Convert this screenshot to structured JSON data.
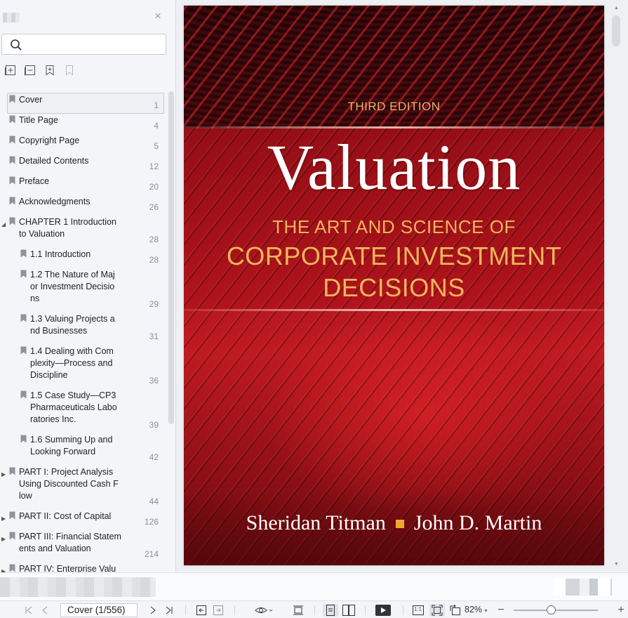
{
  "sidebar": {
    "close_icon": "×",
    "search": {
      "value": "",
      "placeholder": ""
    },
    "tools": [
      "expand-all-icon",
      "collapse-all-icon",
      "add-bookmark-icon",
      "bookmark-outline-icon"
    ],
    "toc": [
      {
        "label": "Cover",
        "page": "1",
        "level": 0,
        "selected": true
      },
      {
        "label": "Title Page",
        "page": "4",
        "level": 0
      },
      {
        "label": "Copyright Page",
        "page": "5",
        "level": 0
      },
      {
        "label": "Detailed Contents",
        "page": "12",
        "level": 0
      },
      {
        "label": "Preface",
        "page": "20",
        "level": 0
      },
      {
        "label": "Acknowledgments",
        "page": "26",
        "level": 0
      },
      {
        "label": "CHAPTER 1 Introduction\nto Valuation",
        "page": "28",
        "level": 0,
        "expanded": true
      },
      {
        "label": "1.1 Introduction",
        "page": "28",
        "level": 1
      },
      {
        "label": "1.2 The Nature of Maj\nor Investment Decisio\nns",
        "page": "29",
        "level": 1
      },
      {
        "label": "1.3 Valuing Projects a\nnd Businesses",
        "page": "31",
        "level": 1
      },
      {
        "label": "1.4 Dealing with Com\nplexity—Process and\nDiscipline",
        "page": "36",
        "level": 1
      },
      {
        "label": "1.5 Case Study—CP3\nPharmaceuticals Labo\nratories Inc.",
        "page": "39",
        "level": 1
      },
      {
        "label": "1.6 Summing Up and\nLooking Forward",
        "page": "42",
        "level": 1
      },
      {
        "label": "PART I: Project Analysis\nUsing Discounted Cash F\nlow",
        "page": "44",
        "level": 0,
        "collapsed": true
      },
      {
        "label": "PART II: Cost of Capital",
        "page": "126",
        "level": 0,
        "collapsed": true
      },
      {
        "label": "PART III: Financial Statem\nents and Valuation",
        "page": "214",
        "level": 0,
        "collapsed": true
      },
      {
        "label": "PART IV: Enterprise Valu",
        "page": "",
        "level": 0,
        "collapsed": true
      }
    ]
  },
  "cover": {
    "edition": "THIRD EDITION",
    "title": "Valuation",
    "subtitle_1": "THE ART AND SCIENCE OF",
    "subtitle_2": "CORPORATE INVESTMENT",
    "subtitle_3": "DECISIONS",
    "author_1": "Sheridan Titman",
    "author_2": "John D. Martin",
    "colors": {
      "background": "#a5141c",
      "accent": "#f0b55c",
      "title": "#ffffff"
    }
  },
  "statusbar": {
    "page_indicator": "Cover (1/556)",
    "zoom": "82%",
    "fit_page_label": "1:1",
    "zoom_slider_fraction": 0.45
  }
}
